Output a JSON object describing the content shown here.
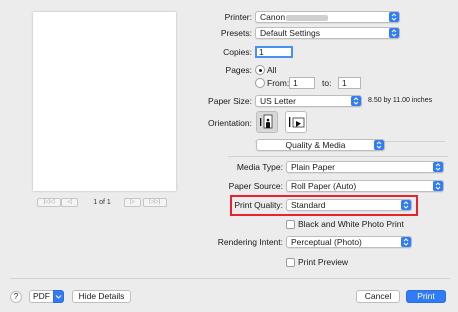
{
  "preview": {
    "page_indicator": "1 of 1",
    "nav_first": "|◁◁",
    "nav_prev": "◁",
    "nav_next": "▷",
    "nav_last": "▷▷|"
  },
  "printer": {
    "label": "Printer:",
    "value": "Canon"
  },
  "presets": {
    "label": "Presets:",
    "value": "Default Settings"
  },
  "copies": {
    "label": "Copies:",
    "value": "1"
  },
  "pages": {
    "label": "Pages:",
    "all_label": "All",
    "from_label": "From:",
    "from_value": "1",
    "to_label": "to:",
    "to_value": "1",
    "selected": "All"
  },
  "paper_size": {
    "label": "Paper Size:",
    "value": "US Letter",
    "dimensions": "8.50 by 11.00 inches"
  },
  "orientation": {
    "label": "Orientation:",
    "selected": "portrait"
  },
  "section_popup": {
    "value": "Quality & Media"
  },
  "media_type": {
    "label": "Media Type:",
    "value": "Plain Paper"
  },
  "paper_source": {
    "label": "Paper Source:",
    "value": "Roll Paper (Auto)"
  },
  "print_quality": {
    "label": "Print Quality:",
    "value": "Standard"
  },
  "bw_photo": {
    "label": "Black and White Photo Print",
    "checked": false
  },
  "rendering_intent": {
    "label": "Rendering Intent:",
    "value": "Perceptual (Photo)"
  },
  "print_preview": {
    "label": "Print Preview",
    "checked": false
  },
  "footer": {
    "help": "?",
    "pdf": "PDF",
    "hide_details": "Hide Details",
    "cancel": "Cancel",
    "print": "Print"
  },
  "colors": {
    "accent": "#2f7cf6",
    "highlight": "#e8232a",
    "background": "#ececec"
  }
}
